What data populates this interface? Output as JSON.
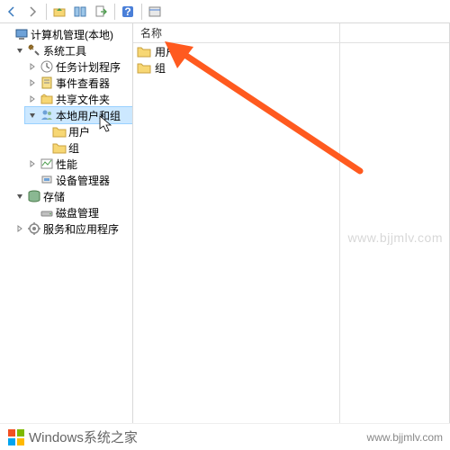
{
  "toolbar": {
    "back": "back",
    "forward": "forward",
    "up": "up",
    "show_hide": "show-hide",
    "export": "export",
    "refresh": "refresh",
    "help": "help",
    "properties": "properties"
  },
  "tree": {
    "root": "计算机管理(本地)",
    "system_tools": "系统工具",
    "task_scheduler": "任务计划程序",
    "event_viewer": "事件查看器",
    "shared_folders": "共享文件夹",
    "local_users_groups": "本地用户和组",
    "users_folder": "用户",
    "groups_folder": "组",
    "performance": "性能",
    "device_manager": "设备管理器",
    "storage": "存储",
    "disk_management": "磁盘管理",
    "services_apps": "服务和应用程序"
  },
  "list": {
    "column_name": "名称",
    "items": [
      {
        "label": "用户"
      },
      {
        "label": "组"
      }
    ]
  },
  "watermark": "www.bjjmlv.com",
  "footer": {
    "brand": "Windows系统之家",
    "url": "www.bjjmlv.com"
  }
}
